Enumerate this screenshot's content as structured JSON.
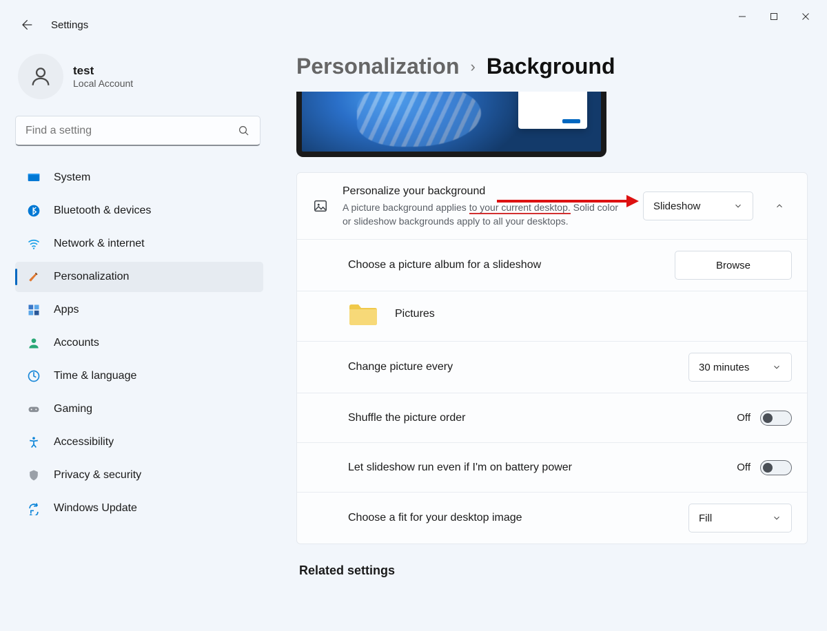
{
  "app": {
    "title": "Settings"
  },
  "user": {
    "name": "test",
    "account": "Local Account"
  },
  "search": {
    "placeholder": "Find a setting"
  },
  "nav": {
    "system": "System",
    "bluetooth": "Bluetooth & devices",
    "network": "Network & internet",
    "personalization": "Personalization",
    "apps": "Apps",
    "accounts": "Accounts",
    "time": "Time & language",
    "gaming": "Gaming",
    "accessibility": "Accessibility",
    "privacy": "Privacy & security",
    "update": "Windows Update"
  },
  "breadcrumb": {
    "parent": "Personalization",
    "current": "Background"
  },
  "rows": {
    "personalize": {
      "title": "Personalize your background",
      "desc1": "A picture background applies ",
      "desc_red": "to your current desktop.",
      "desc2": " Solid color or slideshow backgrounds apply to all your desktops.",
      "value": "Slideshow"
    },
    "album": {
      "title": "Choose a picture album for a slideshow",
      "button": "Browse",
      "folder": "Pictures"
    },
    "interval": {
      "title": "Change picture every",
      "value": "30 minutes"
    },
    "shuffle": {
      "title": "Shuffle the picture order",
      "value": "Off"
    },
    "battery": {
      "title": "Let slideshow run even if I'm on battery power",
      "value": "Off"
    },
    "fit": {
      "title": "Choose a fit for your desktop image",
      "value": "Fill"
    }
  },
  "related": {
    "heading": "Related settings"
  }
}
